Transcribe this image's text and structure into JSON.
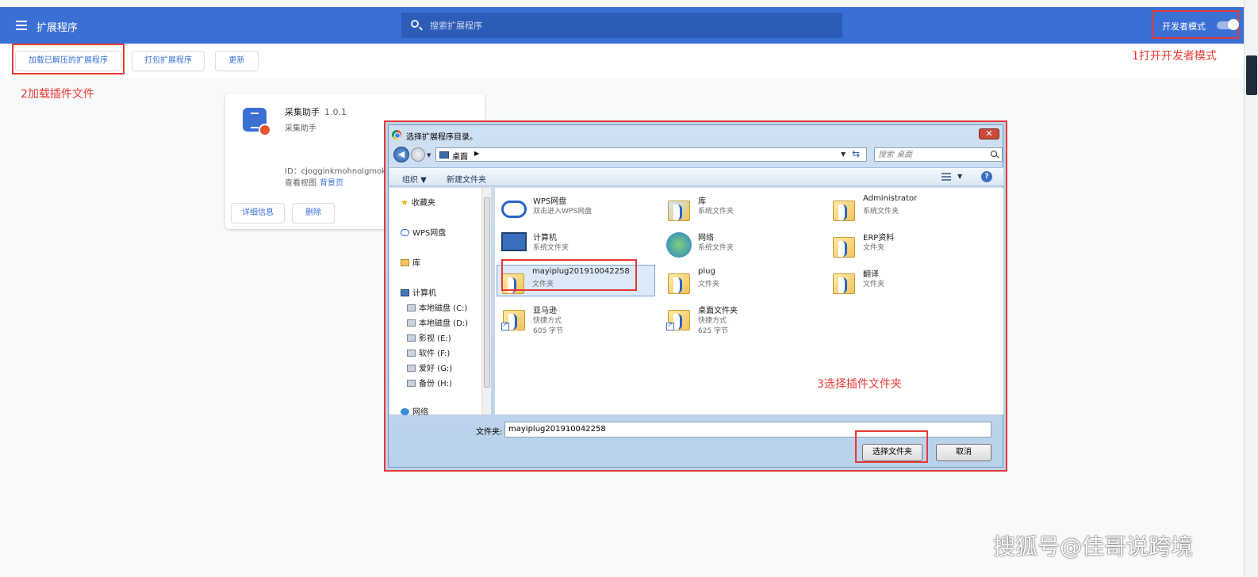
{
  "header": {
    "title": "扩展程序",
    "search_placeholder": "搜索扩展程序",
    "dev_mode_label": "开发者模式"
  },
  "toolbar": {
    "load_unpacked": "加载已解压的扩展程序",
    "pack": "打包扩展程序",
    "update": "更新"
  },
  "annotations": {
    "step1": "1打开开发者模式",
    "step2": "2加载插件文件",
    "step3": "3选择插件文件夹"
  },
  "extension": {
    "name": "采集助手",
    "version": "1.0.1",
    "description": "采集助手",
    "id": "ID：cjogginkmohnolgmoke",
    "views_label": "查看视图",
    "views_link": "背景页",
    "details_button": "详细信息",
    "remove_button": "删除"
  },
  "dialog": {
    "title": "选择扩展程序目录。",
    "address": "桌面",
    "search_placeholder": "搜索 桌面",
    "organize": "组织 ▼",
    "new_folder": "新建文件夹",
    "nav": {
      "favorites": "收藏夹",
      "wps": "WPS网盘",
      "library": "库",
      "computer": "计算机",
      "drives": [
        "本地磁盘 (C:)",
        "本地磁盘 (D:)",
        "影视 (E:)",
        "软件 (F:)",
        "爱好 (G:)",
        "备份 (H:)"
      ],
      "network": "网络"
    },
    "items": [
      {
        "name": "WPS网盘",
        "type": "双击进入WPS网盘",
        "size": ""
      },
      {
        "name": "库",
        "type": "系统文件夹",
        "size": ""
      },
      {
        "name": "Administrator",
        "type": "系统文件夹",
        "size": ""
      },
      {
        "name": "计算机",
        "type": "系统文件夹",
        "size": ""
      },
      {
        "name": "网络",
        "type": "系统文件夹",
        "size": ""
      },
      {
        "name": "ERP资料",
        "type": "文件夹",
        "size": ""
      },
      {
        "name": "mayiplug201910042258",
        "type": "文件夹",
        "size": ""
      },
      {
        "name": "plug",
        "type": "文件夹",
        "size": ""
      },
      {
        "name": "翻译",
        "type": "文件夹",
        "size": ""
      },
      {
        "name": "亚马逊",
        "type": "快捷方式",
        "size": "605 字节"
      },
      {
        "name": "桌面文件夹",
        "type": "快捷方式",
        "size": "625 字节"
      }
    ],
    "folder_label": "文件夹:",
    "folder_value": "mayiplug201910042258",
    "select_button": "选择文件夹",
    "cancel_button": "取消"
  },
  "watermark": "搜狐号@佳哥说跨境"
}
